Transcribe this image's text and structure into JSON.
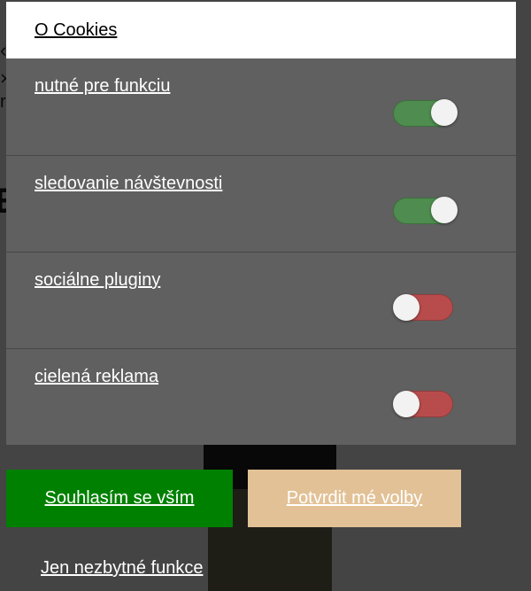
{
  "modal": {
    "title": "O Cookies",
    "categories": [
      {
        "label": "nutné pre funkciu",
        "enabled": true
      },
      {
        "label": "sledovanie návštevnosti",
        "enabled": true
      },
      {
        "label": "sociálne pluginy",
        "enabled": false
      },
      {
        "label": "cielená reklama",
        "enabled": false
      }
    ]
  },
  "buttons": {
    "accept_all": "Souhlasím se vším",
    "confirm_choices": "Potvrdit mé volby",
    "necessary_only": "Jen nezbytné funkce"
  },
  "colors": {
    "overlay": "#606060",
    "toggle_on": "#4f8c4f",
    "toggle_off": "#b84c4c",
    "accept_button": "#008000",
    "confirm_button": "#e2c196"
  }
}
